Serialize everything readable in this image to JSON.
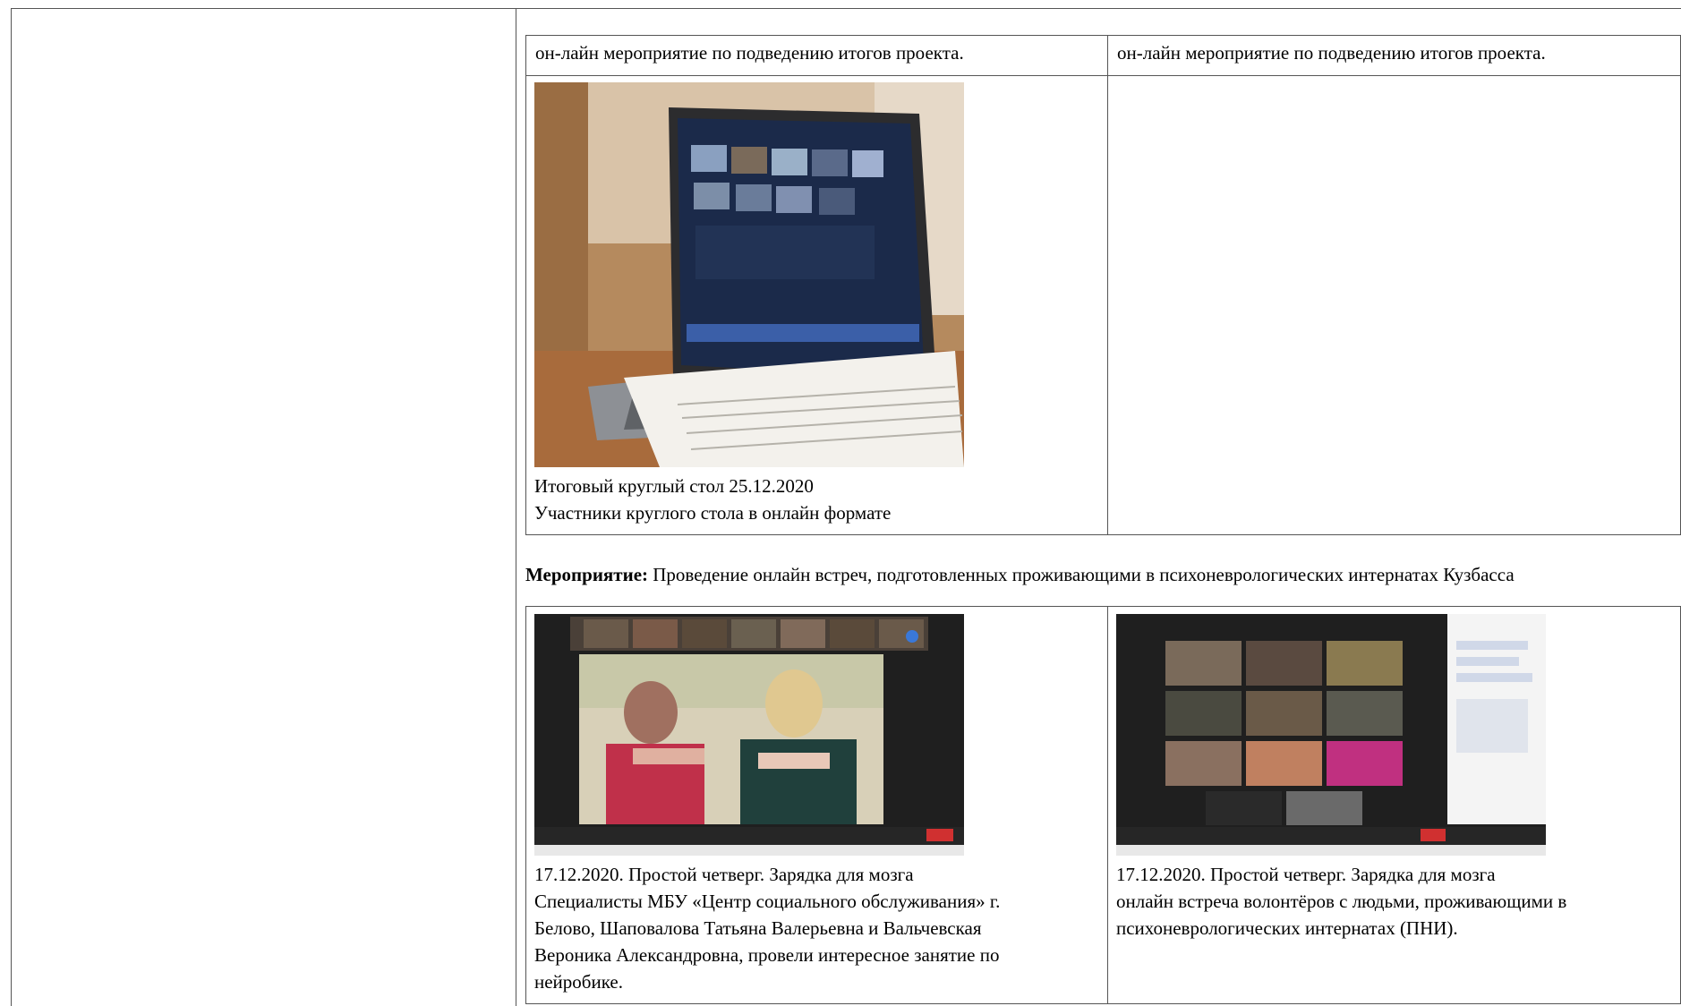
{
  "table1": {
    "row1_col1": "он-лайн мероприятие по подведению итогов проекта.",
    "row1_col2": "он-лайн мероприятие по подведению итогов проекта.",
    "photo1_caption_line1": "Итоговый круглый стол 25.12.2020",
    "photo1_caption_line2": "Участники круглого стола в онлайн формате"
  },
  "section": {
    "label": "Мероприятие:",
    "text": " Проведение онлайн встреч, подготовленных проживающими в психоневрологических интернатах Кузбасса"
  },
  "table2": {
    "left_caption": [
      "17.12.2020. Простой четверг. Зарядка для мозга",
      "Специалисты МБУ «Центр социального обслуживания» г.",
      "Белово, Шаповалова Татьяна Валерьевна и Вальчевская",
      "Вероника Александровна, провели интересное занятие по",
      "нейробике."
    ],
    "right_caption": [
      "17.12.2020. Простой четверг. Зарядка для мозга",
      "онлайн встреча волонтёров с людьми, проживающими в",
      "психоневрологических интернатах (ПНИ)."
    ]
  },
  "colors": {
    "border": "#555555",
    "zoom_bg": "#1f1f1f",
    "laptop_screen": "#1b2a4a"
  }
}
